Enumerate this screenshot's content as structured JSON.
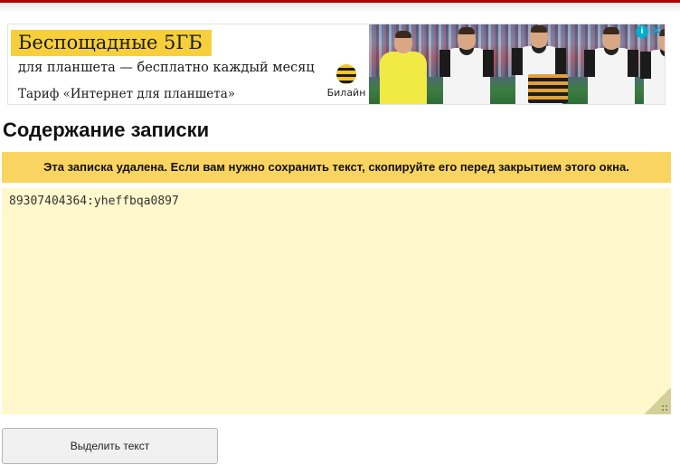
{
  "ad": {
    "headline": "Беспощадные 5ГБ",
    "subline": "для планшета — бесплатно каждый месяц",
    "tariff": "Тариф «Интернет для планшета»",
    "brand": "Билайн",
    "choices_icon": "info-icon",
    "close_icon": "close-icon",
    "accent_color": "#f7cf3a"
  },
  "note": {
    "title": "Содержание записки",
    "warning": "Эта записка удалена. Если вам нужно сохранить текст, скопируйте его перед закрытием этого окна.",
    "content": "89307404364:yheffbqa0897",
    "warning_color": "#fad460",
    "note_bg_color": "#fff8cc"
  },
  "actions": {
    "select_text_label": "Выделить текст"
  }
}
